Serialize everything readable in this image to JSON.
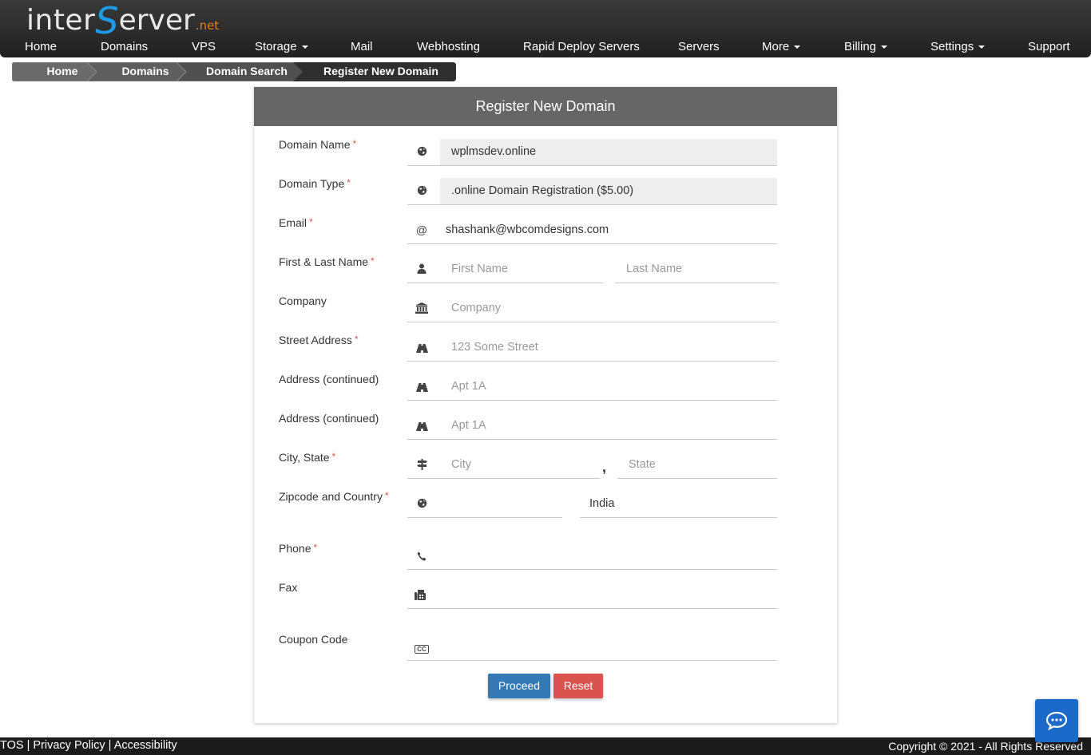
{
  "brand": {
    "part1": "inter",
    "part2": "S",
    "part3": "erver",
    "suffix": ".net"
  },
  "nav": [
    {
      "label": "Home"
    },
    {
      "label": "Domains"
    },
    {
      "label": "VPS"
    },
    {
      "label": "Storage",
      "dropdown": true
    },
    {
      "label": "Mail"
    },
    {
      "label": "Webhosting"
    },
    {
      "label": "Rapid Deploy Servers"
    },
    {
      "label": "Servers"
    },
    {
      "label": "More",
      "dropdown": true
    },
    {
      "label": "Billing",
      "dropdown": true
    },
    {
      "label": "Settings",
      "dropdown": true
    },
    {
      "label": "Support"
    }
  ],
  "breadcrumb": [
    "Home",
    "Domains",
    "Domain Search",
    "Register New Domain"
  ],
  "form": {
    "title": "Register New Domain",
    "required_mark": "*",
    "domain_name": {
      "label": "Domain Name",
      "value": "wplmsdev.online",
      "icon": "globe-icon"
    },
    "domain_type": {
      "label": "Domain Type",
      "value": ".online Domain Registration ($5.00)",
      "icon": "globe-icon"
    },
    "email": {
      "label": "Email",
      "value": "shashank@wbcomdesigns.com",
      "icon": "at-icon",
      "icon_text": "@"
    },
    "name": {
      "label": "First & Last Name",
      "first_placeholder": "First Name",
      "last_placeholder": "Last Name",
      "icon": "user-icon"
    },
    "company": {
      "label": "Company",
      "placeholder": "Company",
      "icon": "bank-icon"
    },
    "street": {
      "label": "Street Address",
      "placeholder": "123 Some Street",
      "icon": "road-icon"
    },
    "address2": {
      "label": "Address (continued)",
      "placeholder": "Apt 1A",
      "icon": "road-icon"
    },
    "address3": {
      "label": "Address (continued)",
      "placeholder": "Apt 1A",
      "icon": "road-icon"
    },
    "city_state": {
      "label": "City, State",
      "city_placeholder": "City",
      "state_placeholder": "State",
      "separator": ",",
      "icon": "signpost-icon"
    },
    "zip_country": {
      "label": "Zipcode and Country",
      "zip_value": "",
      "country_value": "India",
      "icon": "globe-icon"
    },
    "phone": {
      "label": "Phone",
      "value": "",
      "icon": "phone-icon"
    },
    "fax": {
      "label": "Fax",
      "value": "",
      "icon": "fax-icon"
    },
    "coupon": {
      "label": "Coupon Code",
      "value": "",
      "icon": "cc-icon",
      "icon_text": "CC"
    },
    "proceed_label": "Proceed",
    "reset_label": "Reset"
  },
  "footer": {
    "links": [
      "TOS",
      "Privacy Policy",
      "Accessibility"
    ],
    "separator": "|",
    "copyright": "Copyright © 2021 - All Rights Reserved"
  },
  "chat": {
    "icon": "chat-icon"
  },
  "colors": {
    "primary": "#337ab7",
    "danger": "#d9534f",
    "header": "#666666",
    "brand_blue": "#1e9be6",
    "brand_orange": "#e0801e"
  }
}
